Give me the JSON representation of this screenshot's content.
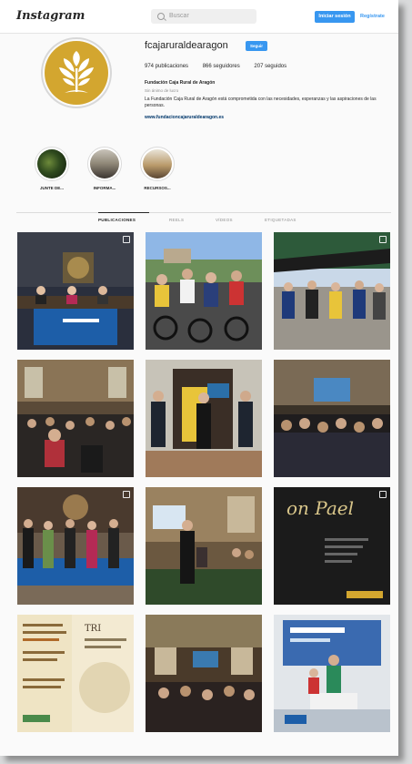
{
  "header": {
    "logo": "Instagram",
    "search_placeholder": "Buscar",
    "login_label": "Iniciar sesión",
    "register_label": "Regístrate"
  },
  "profile": {
    "username": "fcajaruraldearagon",
    "follow_label": "Seguir",
    "stats": {
      "posts": "974 publicaciones",
      "followers": "866 seguidores",
      "following": "207 seguidos"
    },
    "name": "Fundación Caja Rural de Aragón",
    "category": "Sin ánimo de lucro",
    "bio": "La Fundación Caja Rural de Aragón está comprometida con las necesidades, esperanzas y las aspiraciones de las personas.",
    "link": "www.fundacioncajaruraldearagon.es"
  },
  "highlights": [
    {
      "label": "JUNTE DE..."
    },
    {
      "label": "INFORMA..."
    },
    {
      "label": "RECURSOS..."
    }
  ],
  "tabs": [
    {
      "label": "PUBLICACIONES"
    },
    {
      "label": "REELS"
    },
    {
      "label": "VÍDEOS"
    },
    {
      "label": "ETIQUETADAS"
    }
  ],
  "colors": {
    "accent": "#3897f0",
    "brand_gold": "#d3a62f"
  },
  "posts": [
    {
      "scene": "conference-panel"
    },
    {
      "scene": "cyclists-group"
    },
    {
      "scene": "race-finish"
    },
    {
      "scene": "audience-hall"
    },
    {
      "scene": "stage-speakers"
    },
    {
      "scene": "seated-audience"
    },
    {
      "scene": "award-group"
    },
    {
      "scene": "podium-speaker"
    },
    {
      "scene": "dark-poster"
    },
    {
      "scene": "event-poster"
    },
    {
      "scene": "ornate-hall"
    },
    {
      "scene": "sports-podium"
    }
  ]
}
